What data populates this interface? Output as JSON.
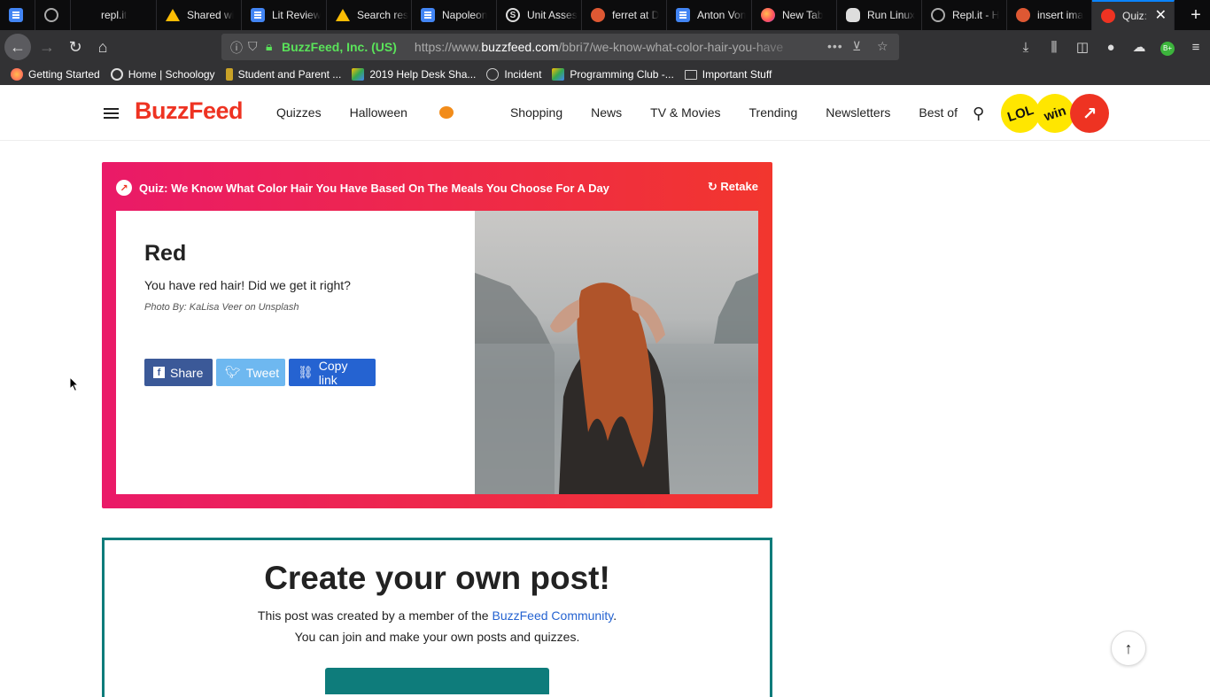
{
  "browser": {
    "tabs": [
      {
        "label": "",
        "icon": "doc-icon"
      },
      {
        "label": "",
        "icon": "replit-icon"
      },
      {
        "label": "repl.it",
        "icon": ""
      },
      {
        "label": "Shared wi",
        "icon": "drive-icon"
      },
      {
        "label": "Lit Review",
        "icon": "doc-icon"
      },
      {
        "label": "Search res",
        "icon": "drive-icon"
      },
      {
        "label": "Napoleon",
        "icon": "doc-icon"
      },
      {
        "label": "Unit Asses",
        "icon": "schoology-icon"
      },
      {
        "label": "ferret at D",
        "icon": "duckduckgo-icon"
      },
      {
        "label": "Anton Von",
        "icon": "doc-icon"
      },
      {
        "label": "New Tab",
        "icon": "firefox-icon"
      },
      {
        "label": "Run Linux",
        "icon": "linux-icon"
      },
      {
        "label": "Repl.it - H",
        "icon": "replit-icon"
      },
      {
        "label": "insert ima",
        "icon": "duckduckgo-icon"
      },
      {
        "label": "Quiz: W",
        "icon": "buzzfeed-icon"
      }
    ],
    "new_tab": "+",
    "url_org": "BuzzFeed, Inc. (US)",
    "url_prefix": "https://www.",
    "url_domain": "buzzfeed.com",
    "url_path": "/bbri7/we-know-what-color-hair-you-have",
    "bookmarks": [
      "Getting Started",
      "Home | Schoology",
      "Student and Parent ...",
      "2019 Help Desk Sha...",
      "Incident",
      "Programming Club -...",
      "Important Stuff"
    ],
    "profile_badge": "B+"
  },
  "header": {
    "logo": "BuzzFeed",
    "nav": [
      "Quizzes",
      "Halloween",
      "Shopping",
      "News",
      "TV & Movies",
      "Trending",
      "Newsletters",
      "Best of the Week"
    ],
    "badges": [
      "LOL",
      "win",
      ""
    ]
  },
  "quiz": {
    "title": "Quiz: We Know What Color Hair You Have Based On The Meals You Choose For A Day",
    "retake": "Retake",
    "result_title": "Red",
    "result_desc": "You have red hair! Did we get it right?",
    "photo_credit": "Photo By: KaLisa Veer on Unsplash",
    "share": "Share",
    "tweet": "Tweet",
    "copy_link": "Copy link"
  },
  "create": {
    "title": "Create your own post!",
    "line1_pre": "This post was created by a member of the ",
    "line1_link": "BuzzFeed Community",
    "line1_post": ".",
    "line2": "You can join and make your own posts and quizzes."
  },
  "colors": {
    "brand": "#ee3322",
    "quiz_gradient_start": "#ea1a68",
    "quiz_gradient_end": "#f2362e",
    "teal": "#0e7c7b",
    "facebook": "#3b5998",
    "twitter": "#55acee",
    "copylink": "#2563d1"
  }
}
